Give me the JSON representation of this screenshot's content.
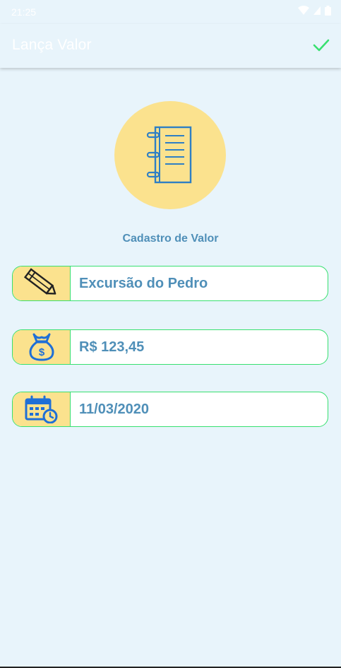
{
  "status_bar": {
    "time": "21:25"
  },
  "app_bar": {
    "title": "Lança Valor",
    "confirm_icon": "check-icon"
  },
  "hero": {
    "icon": "notebook-icon"
  },
  "section": {
    "title": "Cadastro de Valor"
  },
  "fields": {
    "description": {
      "icon": "pencil-icon",
      "value": "Excursão do Pedro"
    },
    "amount": {
      "icon": "money-bag-icon",
      "value": "R$ 123,45"
    },
    "date": {
      "icon": "calendar-clock-icon",
      "value": "11/03/2020"
    }
  },
  "colors": {
    "background": "#e8f4fb",
    "accent_yellow": "#fbe28e",
    "field_border": "#38e070",
    "text_blue": "#4f8fb8",
    "icon_blue": "#1f6fd6"
  }
}
